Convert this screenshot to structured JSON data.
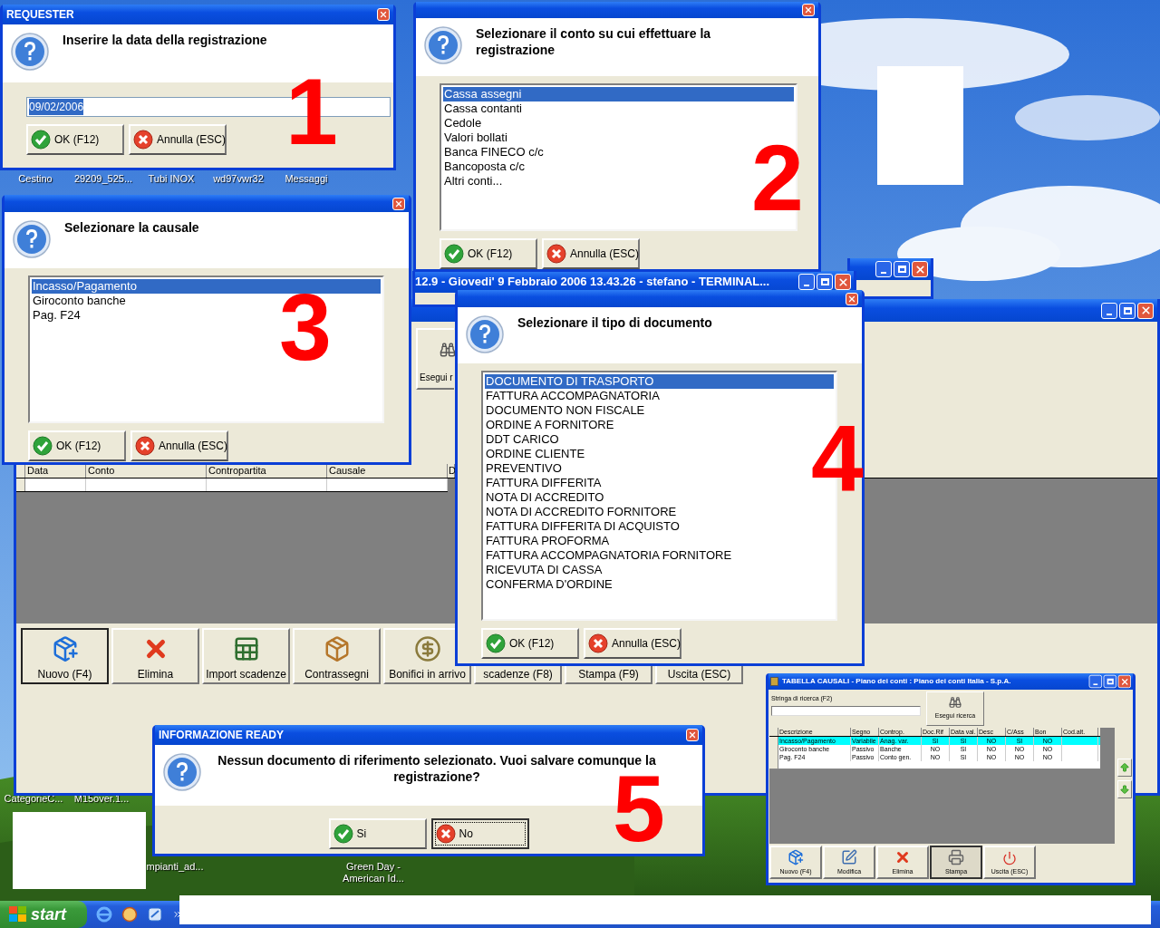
{
  "desktop": {
    "icons_top": [
      {
        "label": "Cestino"
      },
      {
        "label": "29209_525..."
      },
      {
        "label": "Tubi INOX"
      },
      {
        "label": "wd97vwr32"
      },
      {
        "label": "Messaggi"
      }
    ],
    "icons_bottom": [
      {
        "label": "CategorieC..."
      },
      {
        "label": "M15over.1..."
      },
      {
        "label": "mpianti_ad..."
      },
      {
        "label": "Green Day - American Id..."
      }
    ]
  },
  "back_window": {
    "title": "12.9 - Giovedi' 9 Febbraio 2006  13.43.26 - stefano - TERMINAL..."
  },
  "main_window": {
    "search_button": "Esegui r",
    "table": {
      "columns": [
        "Data",
        "Conto",
        "Contropartita",
        "Causale",
        "D"
      ]
    },
    "toolbar": [
      {
        "label": "Nuovo (F4)",
        "pressed": true
      },
      {
        "label": "Elimina",
        "pressed": false
      },
      {
        "label": "Import scadenze",
        "pressed": false
      },
      {
        "label": "Contrassegni",
        "pressed": false
      },
      {
        "label": "Bonifici in arrivo",
        "pressed": false
      },
      {
        "label": "scadenze (F8)",
        "pressed": false
      },
      {
        "label": "Stampa (F9)",
        "pressed": false
      },
      {
        "label": "Uscita (ESC)",
        "pressed": false
      }
    ]
  },
  "dialogs": [
    {
      "kind": "input",
      "title": "REQUESTER",
      "prompt": "Inserire la data della registrazione",
      "value": "09/02/2006",
      "value_selected": true,
      "buttons": [
        {
          "label": "OK (F12)",
          "kind": "ok"
        },
        {
          "label": "Annulla (ESC)",
          "kind": "cancel"
        }
      ],
      "badge": "1"
    },
    {
      "kind": "list",
      "prompt": "Selezionare il conto su cui effettuare la registrazione",
      "items": [
        {
          "label": "Cassa assegni",
          "selected": true
        },
        {
          "label": "Cassa contanti",
          "selected": false
        },
        {
          "label": "Cedole",
          "selected": false
        },
        {
          "label": "Valori bollati",
          "selected": false
        },
        {
          "label": "Banca FINECO c/c",
          "selected": false
        },
        {
          "label": "Bancoposta c/c",
          "selected": false
        },
        {
          "label": "Altri conti...",
          "selected": false
        }
      ],
      "buttons": [
        {
          "label": "OK (F12)",
          "kind": "ok"
        },
        {
          "label": "Annulla (ESC)",
          "kind": "cancel"
        }
      ],
      "badge": "2"
    },
    {
      "kind": "list",
      "prompt": "Selezionare la causale",
      "items": [
        {
          "label": "Incasso/Pagamento",
          "selected": true
        },
        {
          "label": "Giroconto banche",
          "selected": false
        },
        {
          "label": "Pag. F24",
          "selected": false
        }
      ],
      "buttons": [
        {
          "label": "OK (F12)",
          "kind": "ok"
        },
        {
          "label": "Annulla (ESC)",
          "kind": "cancel"
        }
      ],
      "badge": "3"
    },
    {
      "kind": "list",
      "prompt": "Selezionare il tipo di documento",
      "items": [
        {
          "label": "DOCUMENTO DI TRASPORTO",
          "selected": true
        },
        {
          "label": "FATTURA ACCOMPAGNATORIA",
          "selected": false
        },
        {
          "label": "DOCUMENTO NON FISCALE",
          "selected": false
        },
        {
          "label": "ORDINE A FORNITORE",
          "selected": false
        },
        {
          "label": "DDT CARICO",
          "selected": false
        },
        {
          "label": "ORDINE CLIENTE",
          "selected": false
        },
        {
          "label": "PREVENTIVO",
          "selected": false
        },
        {
          "label": "FATTURA DIFFERITA",
          "selected": false
        },
        {
          "label": "NOTA DI ACCREDITO",
          "selected": false
        },
        {
          "label": "NOTA DI ACCREDITO FORNITORE",
          "selected": false
        },
        {
          "label": "FATTURA DIFFERITA DI ACQUISTO",
          "selected": false
        },
        {
          "label": "FATTURA PROFORMA",
          "selected": false
        },
        {
          "label": "FATTURA ACCOMPAGNATORIA FORNITORE",
          "selected": false
        },
        {
          "label": "RICEVUTA DI CASSA",
          "selected": false
        },
        {
          "label": "CONFERMA D'ORDINE",
          "selected": false
        }
      ],
      "buttons": [
        {
          "label": "OK (F12)",
          "kind": "ok"
        },
        {
          "label": "Annulla (ESC)",
          "kind": "cancel"
        }
      ],
      "badge": "4"
    },
    {
      "kind": "message",
      "title": "INFORMAZIONE READY",
      "prompt": "Nessun documento di riferimento selezionato. Vuoi salvare comunque la registrazione?",
      "buttons": [
        {
          "label": "Si",
          "kind": "ok",
          "focused": false
        },
        {
          "label": "No",
          "kind": "cancel",
          "focused": true
        }
      ],
      "badge": "5"
    }
  ],
  "causali_window": {
    "title": "TABELLA CAUSALI - Piano dei conti : Piano dei conti Italia - S.p.A.",
    "search_label": "Stringa di ricerca (F2)",
    "search_button": "Esegui ricerca",
    "table": {
      "columns": [
        "Descrizione",
        "Segno",
        "Controp.",
        "Doc.Rif",
        "Data val.",
        "Desc",
        "C/Ass",
        "Bon",
        "Cod.alt."
      ],
      "rows": [
        {
          "cells": [
            "Incasso/Pagamento",
            "Variabile",
            "Anag. var.",
            "SI",
            "SI",
            "NO",
            "SI",
            "NO",
            ""
          ],
          "selected": true
        },
        {
          "cells": [
            "Giroconto banche",
            "Passivo",
            "Banche",
            "NO",
            "SI",
            "NO",
            "NO",
            "NO",
            ""
          ],
          "selected": false
        },
        {
          "cells": [
            "Pag. F24",
            "Passivo",
            "Conto gen.",
            "NO",
            "SI",
            "NO",
            "NO",
            "NO",
            ""
          ],
          "selected": false
        }
      ]
    },
    "toolbar": [
      {
        "label": "Nuovo (F4)",
        "pressed": false
      },
      {
        "label": "Modifica",
        "pressed": false
      },
      {
        "label": "Elimina",
        "pressed": false
      },
      {
        "label": "Stampa",
        "pressed": true
      },
      {
        "label": "Uscita (ESC)",
        "pressed": false
      }
    ]
  },
  "taskbar": {
    "start_label": "start"
  }
}
